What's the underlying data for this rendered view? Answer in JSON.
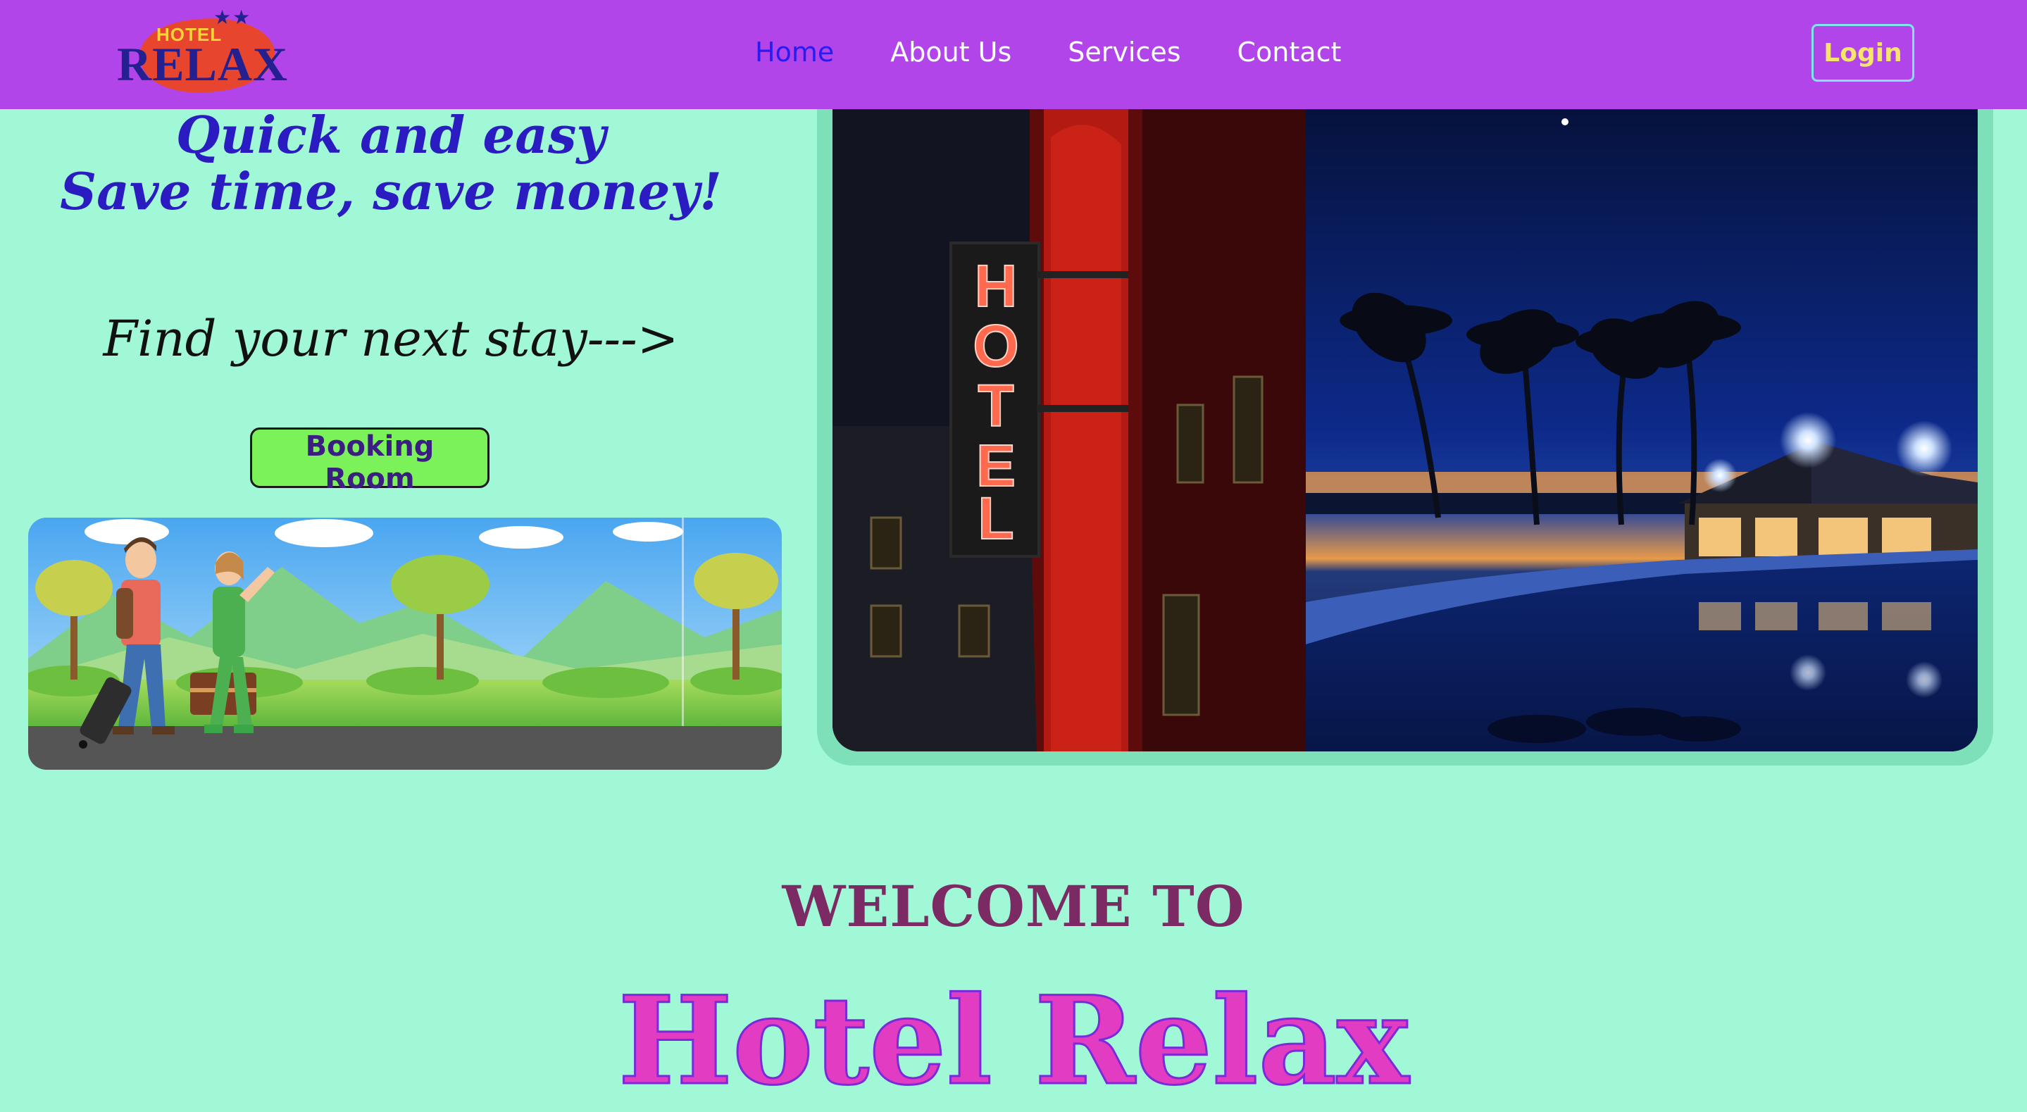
{
  "brand": {
    "logo_small_text": "HOTEL",
    "logo_big_text": "RELAX",
    "logo_stars": "★★",
    "colors": {
      "nav_bg": "#b245ea",
      "logo_blue": "#24208f",
      "logo_red": "#e8452f",
      "logo_yellow": "#f7d33a"
    }
  },
  "nav": {
    "items": [
      {
        "label": "Home",
        "active": true
      },
      {
        "label": "About Us",
        "active": false
      },
      {
        "label": "Services",
        "active": false
      },
      {
        "label": "Contact",
        "active": false
      }
    ],
    "login_label": "Login"
  },
  "hero": {
    "tagline_line1": "Quick and easy",
    "tagline_line2": "Save time, save money!",
    "find_stay": "Find your next stay--->",
    "booking_label": "Booking Room",
    "photo_sign_text": "HOTEL"
  },
  "welcome": {
    "heading": "WELCOME TO",
    "hotel_name": "Hotel Relax"
  },
  "colors": {
    "page_bg": "#a0f8d6",
    "active_nav": "#2a1cf0",
    "booking_bg": "#7cf25a",
    "welcome_color": "#7c2a63",
    "hotel_name_color": "#e23cc2"
  }
}
